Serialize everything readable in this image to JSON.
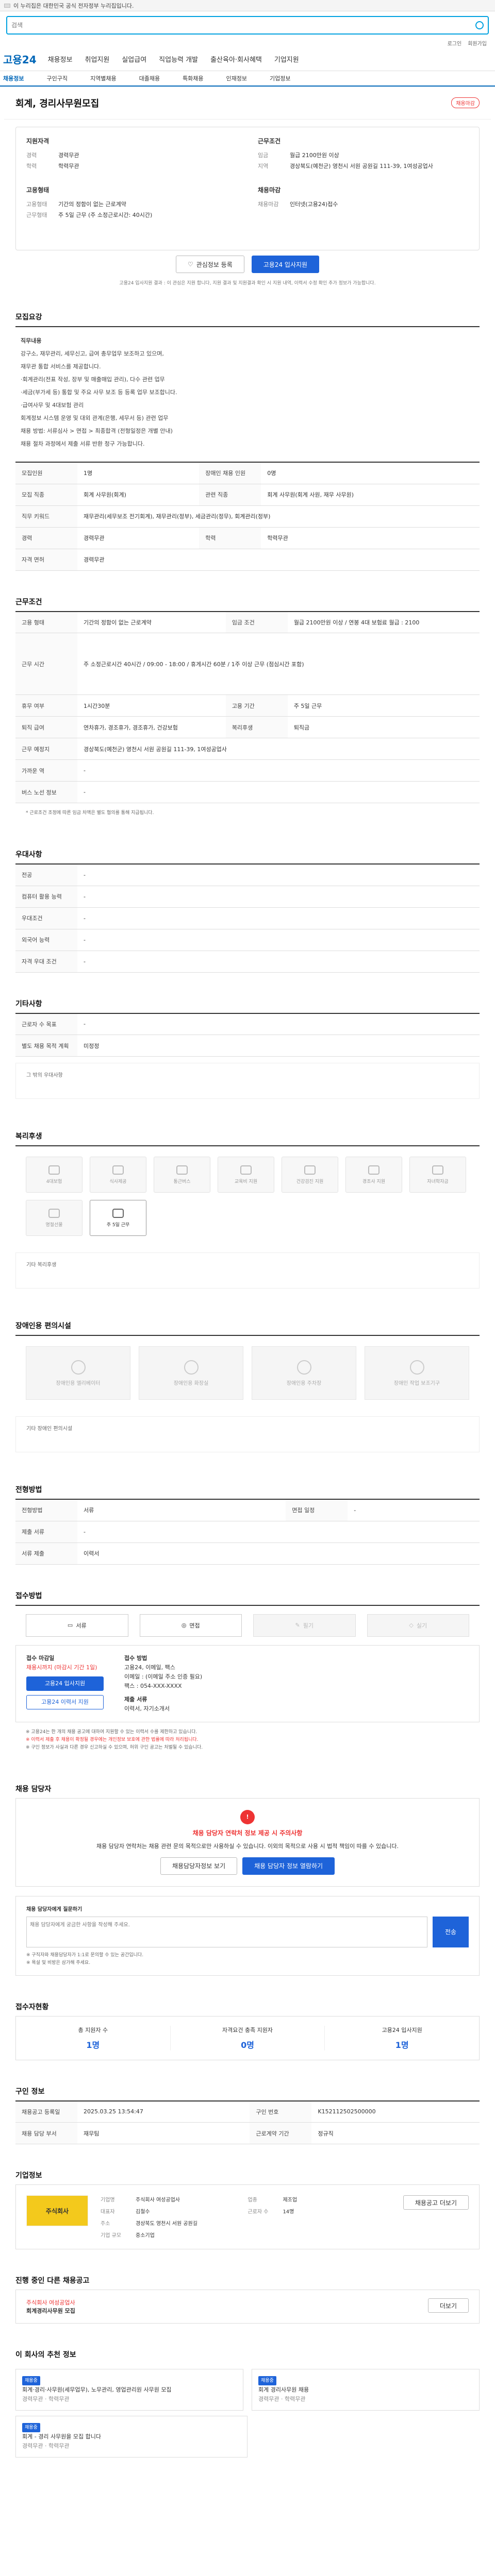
{
  "topbar": {
    "notice": "이 누리집은 대한민국 공식 전자정부 누리집입니다."
  },
  "search": {
    "placeholder": "검색"
  },
  "utils": {
    "links": [
      "로그인",
      "회원가입"
    ]
  },
  "gnb": {
    "logo": "고용24",
    "menu": [
      "채용정보",
      "취업지원",
      "실업급여",
      "직업능력 개발",
      "출산육아·회사혜택",
      "기업지원"
    ]
  },
  "lnb": {
    "items": [
      "채용정보",
      "구인구직",
      "지역별채용",
      "대졸채용",
      "특화채용",
      "인재정보",
      "기업정보"
    ]
  },
  "job": {
    "title": "회계, 경리사무원모집",
    "badge": "채용마감"
  },
  "info_left": {
    "heading": "지원자격",
    "rows": [
      {
        "k": "경력",
        "v": "경력무관"
      },
      {
        "k": "학력",
        "v": "학력무관"
      }
    ],
    "heading2": "고용형태",
    "rows2": [
      {
        "k": "고용형태",
        "v": "기간의 정함이 없는 근로계약"
      },
      {
        "k": "근무형태",
        "v": "주 5일 근무 (주 소정근로시간: 40시간)"
      }
    ]
  },
  "info_right": {
    "heading": "근무조건",
    "rows": [
      {
        "k": "임금",
        "v": "월급 2100만원 이상"
      },
      {
        "k": "지역",
        "v": "경상북도(예천군) 영천시 서원 공원길 111-39, 1여성공업사"
      }
    ],
    "heading2": "채용마감",
    "rows2": [
      {
        "k": "채용마감",
        "v": "인터넷(고용24)접수"
      }
    ]
  },
  "actions": {
    "scrap": "관심정보 등록",
    "apply": "고용24 입사지원"
  },
  "actions_note": "고용24 입사지원 결과 : 이 관심은 지원 합니다, 지원 결과 및 지원결과 확인 시 지원 내역, 이력서 수정 확인 추가 정보가 가능합니다.",
  "sec_job": {
    "title": "모집요강",
    "desc_title": "직무내용",
    "desc": [
      "강구소, 재무관리, 세무신고, 급여 총무업무 보조하고 있으며,",
      "재무관 통합 서비스를 제공합니다.",
      "·회계관리(전표 작성, 장부 및 매출매입 관리), 다수 관련 업무",
      "·세금(부가세 등) 통합 및 주요 사무 보조 등 등록 업무 보조합니다.",
      "·급여사무 및 4대보험 관리",
      "회계정보 시스템 운영 및 대외 관계(은행, 세무서 등) 관련 업무",
      "채용 방법: 서류심사 > 면접 > 최종합격 (전형일정은 개별 안내)",
      "채용 절차 과정에서 제출 서류 반환 청구 가능합니다."
    ],
    "rows": [
      [
        "모집인원",
        "1명",
        "장애인 채용 인원",
        "0명"
      ],
      [
        "모집 직종",
        "회계 사무원(회계)",
        "관련 직종",
        "회계 사무원(회계 사원, 재무 사무원)"
      ],
      [
        "직무 키워드",
        "재무관리(세무보조 전기회계), 재무관리(정부), 세금관리(정무), 회계관리(정부)",
        "",
        ""
      ],
      [
        "경력",
        "경력무관",
        "학력",
        "학력무관"
      ],
      [
        "자격 면허",
        "경력무관",
        "",
        ""
      ]
    ]
  },
  "sec_cond": {
    "title": "근무조건",
    "rows": [
      [
        "고용 형태",
        "기간의 정함이 없는 근로계약",
        "임금 조건",
        "월급 2100만원 이상 / 연봉 4대 보험료 월급 : 2100"
      ],
      [
        "근무 시간",
        "주 소정근로시간 40시간 / 09:00 - 18:00 / 휴게시간 60분 / 1주 이상 근무 (점심시간 포함)",
        "",
        ""
      ],
      [
        "휴무 여부",
        "1시간30분",
        "고용 기간",
        "주 5일 근무"
      ],
      [
        "퇴직 급여",
        "연차휴가, 경조휴가, 경조휴가, 건강보험",
        "복리후생",
        "퇴직금"
      ],
      [
        "근무 예정지",
        "경상북도(예천군) 영천시 서원 공원길 111-39, 1여성공업사",
        "",
        ""
      ],
      [
        "가까운 역",
        "-",
        "",
        ""
      ],
      [
        "버스 노선 정보",
        "-",
        "",
        ""
      ]
    ],
    "note": "* 근로조건 조정에 따른 임금 차액은 별도 협의를 통해 지급됩니다."
  },
  "sec_pref": {
    "title": "우대사항",
    "rows": [
      [
        "전공",
        "-"
      ],
      [
        "컴퓨터 활용 능력",
        "-"
      ],
      [
        "우대조건",
        "-"
      ],
      [
        "외국어 능력",
        "-"
      ],
      [
        "자격 우대 조건",
        "-"
      ]
    ]
  },
  "sec_etc": {
    "title": "기타사항",
    "rows": [
      [
        "근로자 수 목표",
        "-"
      ],
      [
        "별도 채용 목적 계획",
        "미정정"
      ]
    ],
    "msg": "그 밖의 우대사항"
  },
  "sec_welfare": {
    "title": "복리후생",
    "items": [
      "4대보험",
      "식사제공",
      "통근버스",
      "교육비 지원",
      "건강검진 지원",
      "경조사 지원",
      "자녀학자금",
      "명절선물",
      "주 5일 근무"
    ],
    "msg": "기타 복리후생"
  },
  "sec_disab": {
    "title": "장애인용 편의시설",
    "items": [
      "장애인용 엘리베이터",
      "장애인용 화장실",
      "장애인용 주차장",
      "장애인 작업 보조기구"
    ],
    "msg": "기타 장애인 편의시설"
  },
  "sec_rep": {
    "title": "전형방법",
    "rows": [
      [
        "전형방법",
        "서류",
        "면접 일정",
        "-"
      ],
      [
        "제출 서류",
        "-",
        "",
        ""
      ],
      [
        "서류 제출",
        "이력서",
        "",
        ""
      ]
    ]
  },
  "sec_apply": {
    "title": "접수방법",
    "methods": [
      "서류",
      "면접",
      "필기",
      "실기"
    ],
    "left_title": "접수 마감일",
    "left_date": "채용시까지 (마감시 기간 1일)",
    "left_btn1": "고용24 입사지원",
    "left_btn2": "고용24 이력서 지원",
    "mid_title": "접수 방법",
    "mid_items": [
      "고용24, 이메일, 팩스",
      "이메일 : (이메일 주소 인증 필요)",
      "팩스 : 054-XXX-XXXX"
    ],
    "mid_title2": "제출 서류",
    "mid_items2": [
      "이력서, 자기소개서"
    ],
    "notes": [
      "※ 고용24는 한 개의 채용 공고에 대하여 지원할 수 있는 이력서 수를 제한하고 있습니다.",
      "※ 이력서 제출 후 채용이 확정될 경우에는 개인정보 보호에 관한 법률에 따라 처리됩니다.",
      "※ 구인 정보가 사실과 다른 경우 신고하실 수 있으며, 허위 구인 공고는 처벌될 수 있습니다."
    ]
  },
  "sec_contact": {
    "title": "채용 담당자",
    "warn_title": "채용 담당자 연락처 정보 제공 시 주의사항",
    "warn_text": "채용 담당자 연락처는 채용 관련 문의 목적으로만 사용하실 수 있습니다. 이외의 목적으로 사용 시 법적 책임이 따를 수 있습니다.",
    "btn1": "채용담당자정보 보기",
    "btn2": "채용 담당자 정보 열람하기",
    "inq_title": "채용 담당자에게 질문하기",
    "inq_placeholder": "채용 담당자에게 궁금한 사항을 작성해 주세요.",
    "inq_btn": "전송",
    "inq_notes": [
      "※ 구직자와 채용담당자가 1:1로 문의할 수 있는 공간입니다.",
      "※ 욕설 및 비방은 삼가해 주세요."
    ]
  },
  "sec_status": {
    "title": "접수자현황",
    "cells": [
      [
        "총 지원자 수",
        "1명"
      ],
      [
        "자격요건 충족 지원자",
        "0명"
      ],
      [
        "고용24 입사지원",
        "1명"
      ]
    ]
  },
  "sec_info": {
    "title": "구인 정보",
    "rows": [
      [
        "채용공고 등록일",
        "2025.03.25 13:54:47",
        "구인 번호",
        "K152112502500000"
      ],
      [
        "채용 담당 부서",
        "재무팀",
        "근로계약 기간",
        "정규직"
      ]
    ]
  },
  "sec_company": {
    "title": "기업정보",
    "logo": "주식회사",
    "rows": [
      [
        "기업명",
        "주식회사 여성공업사",
        "업종",
        "제조업"
      ],
      [
        "대표자",
        "김철수",
        "근로자 수",
        "14명"
      ],
      [
        "주소",
        "경상북도 영천시 서원 공원길",
        "",
        ""
      ],
      [
        "기업 규모",
        "중소기업",
        "",
        ""
      ]
    ],
    "btn": "채용공고 더보기"
  },
  "sec_related": {
    "title": "진행 중인 다른 채용공고",
    "job": "회계경리사무원 모집",
    "company": "주식회사 여성공업사",
    "more": "더보기"
  },
  "sec_similar": {
    "title": "이 회사의 추천 정보",
    "cards": [
      {
        "tag": "채용중",
        "title": "회계·경리·사무원(세무업무), 노무관리, 영업관리원 사무원 모집",
        "meta": "경력무관 · 학력무관"
      },
      {
        "tag": "채용중",
        "title": "회계 경리사무원 채용",
        "meta": "경력무관 · 학력무관"
      },
      {
        "tag": "채용중",
        "title": "회계 - 경리 사무원을 모집 합니다",
        "meta": "경력무관 · 학력무관"
      }
    ]
  }
}
